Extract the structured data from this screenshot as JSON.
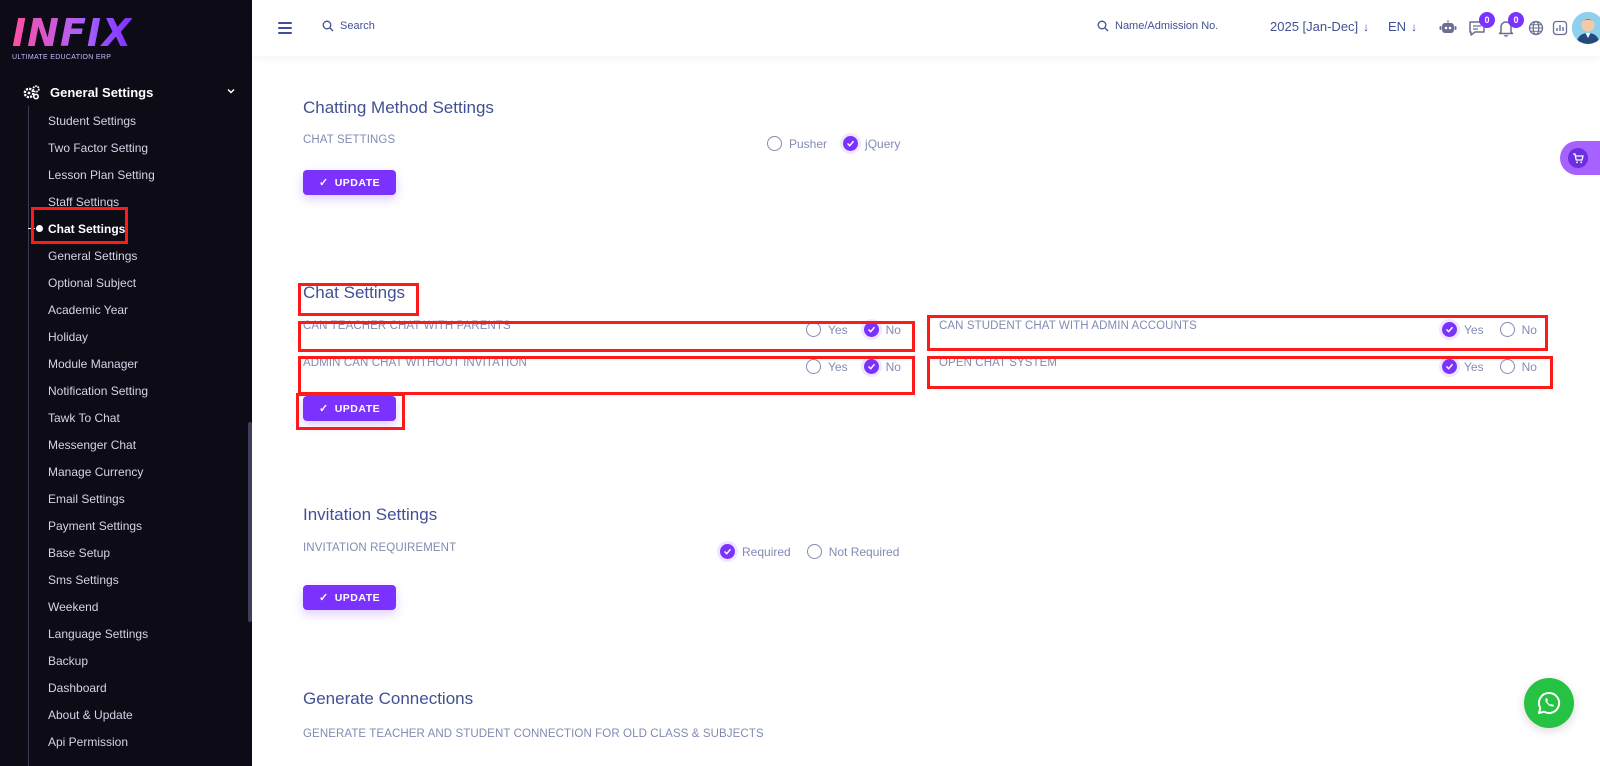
{
  "brand": {
    "logo_text": "INFIX",
    "tagline": "ULTIMATE EDUCATION ERP"
  },
  "sidebar": {
    "group_label": "General Settings",
    "items": [
      {
        "label": "Student Settings"
      },
      {
        "label": "Two Factor Setting"
      },
      {
        "label": "Lesson Plan Setting"
      },
      {
        "label": "Staff Settings"
      },
      {
        "label": "Chat Settings",
        "active": true
      },
      {
        "label": "General Settings"
      },
      {
        "label": "Optional Subject"
      },
      {
        "label": "Academic Year"
      },
      {
        "label": "Holiday"
      },
      {
        "label": "Module Manager"
      },
      {
        "label": "Notification Setting"
      },
      {
        "label": "Tawk To Chat"
      },
      {
        "label": "Messenger Chat"
      },
      {
        "label": "Manage Currency"
      },
      {
        "label": "Email Settings"
      },
      {
        "label": "Payment Settings"
      },
      {
        "label": "Base Setup"
      },
      {
        "label": "Sms Settings"
      },
      {
        "label": "Weekend"
      },
      {
        "label": "Language Settings"
      },
      {
        "label": "Backup"
      },
      {
        "label": "Dashboard"
      },
      {
        "label": "About & Update"
      },
      {
        "label": "Api Permission"
      }
    ]
  },
  "header": {
    "search_label": "Search",
    "admission_search_label": "Name/Admission No.",
    "year_label": "2025 [Jan-Dec]",
    "lang_label": "EN",
    "chat_badge": "0",
    "notification_badge": "0"
  },
  "sections": {
    "chatting_method": {
      "title": "Chatting Method Settings",
      "label": "CHAT SETTINGS",
      "opt1": "Pusher",
      "opt2": "jQuery",
      "selected": "jQuery",
      "button": "UPDATE"
    },
    "chat_settings": {
      "title": "Chat Settings",
      "rows": [
        {
          "label": "CAN TEACHER CHAT WITH PARENTS",
          "yes": "Yes",
          "no": "No",
          "value": "No"
        },
        {
          "label": "CAN STUDENT CHAT WITH ADMIN ACCOUNTS",
          "yes": "Yes",
          "no": "No",
          "value": "Yes"
        },
        {
          "label": "ADMIN CAN CHAT WITHOUT INVITATION",
          "yes": "Yes",
          "no": "No",
          "value": "No"
        },
        {
          "label": "OPEN CHAT SYSTEM",
          "yes": "Yes",
          "no": "No",
          "value": "Yes"
        }
      ],
      "button": "UPDATE"
    },
    "invitation": {
      "title": "Invitation Settings",
      "label": "INVITATION REQUIREMENT",
      "opt1": "Required",
      "opt2": "Not Required",
      "selected": "Required",
      "button": "UPDATE"
    },
    "connections": {
      "title": "Generate Connections",
      "label": "GENERATE TEACHER AND STUDENT CONNECTION FOR OLD CLASS & SUBJECTS"
    }
  },
  "colors": {
    "accent": "#7c32ff",
    "sidebar_bg": "#0c0b16",
    "text": "#415094",
    "muted": "#828bb2",
    "highlight": "#ff1a1a",
    "whatsapp": "#25c244"
  },
  "icons": [
    "menu-icon",
    "search-icon",
    "robot-icon",
    "chat-icon",
    "bell-icon",
    "globe-icon",
    "report-icon",
    "cart-icon",
    "whatsapp-icon",
    "gear-icon",
    "chevron-down-icon"
  ]
}
